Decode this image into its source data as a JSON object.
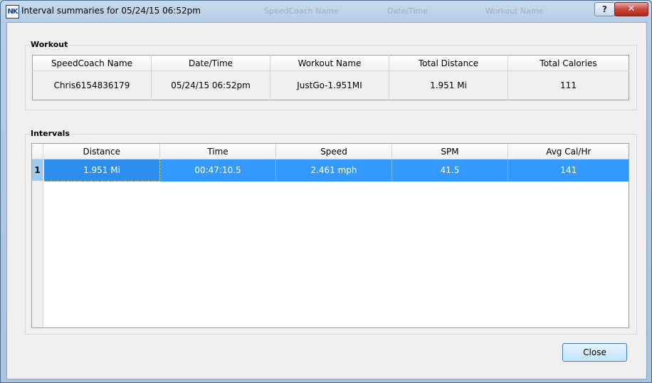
{
  "window": {
    "title": "Interval summaries for 05/24/15 06:52pm",
    "icon": "NK"
  },
  "titlebar_buttons": {
    "help": "?",
    "close": "✕"
  },
  "background_window_headers": [
    "SpeedCoach Name",
    "Date/Time",
    "Workout Name"
  ],
  "workout": {
    "label": "Workout",
    "columns": [
      "SpeedCoach Name",
      "Date/Time",
      "Workout Name",
      "Total Distance",
      "Total Calories"
    ],
    "row": [
      "Chris6154836179",
      "05/24/15 06:52pm",
      "JustGo-1.951MI",
      "1.951 Mi",
      "111"
    ]
  },
  "intervals": {
    "label": "Intervals",
    "columns": [
      "Distance",
      "Time",
      "Speed",
      "SPM",
      "Avg Cal/Hr"
    ],
    "rows": [
      {
        "index": "1",
        "cells": [
          "1.951 Mi",
          "00:47:10.5",
          "2.461 mph",
          "41.5",
          "141"
        ]
      }
    ]
  },
  "buttons": {
    "close": "Close"
  },
  "colors": {
    "selection": "#3399ff",
    "row_header_selected": "#9ecbf3"
  }
}
